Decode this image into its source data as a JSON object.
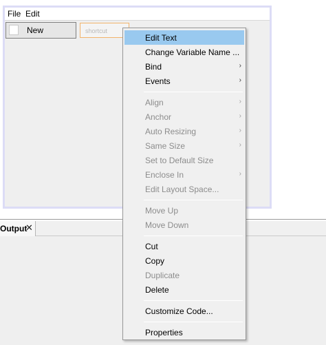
{
  "menubar": {
    "file_label": "File",
    "edit_label": "Edit"
  },
  "designer": {
    "menu_item_label": "New",
    "shortcut_placeholder": "shortcut"
  },
  "output": {
    "tab_label": "Output",
    "close_glyph": "✕"
  },
  "context_menu": {
    "submenu_arrow": "›",
    "items": [
      {
        "label": "Edit Text",
        "enabled": true,
        "highlighted": true,
        "submenu": false
      },
      {
        "label": "Change Variable Name ...",
        "enabled": true,
        "submenu": false
      },
      {
        "label": "Bind",
        "enabled": true,
        "submenu": true
      },
      {
        "label": "Events",
        "enabled": true,
        "submenu": true
      },
      {
        "label": "Align",
        "enabled": false,
        "submenu": true
      },
      {
        "label": "Anchor",
        "enabled": false,
        "submenu": true
      },
      {
        "label": "Auto Resizing",
        "enabled": false,
        "submenu": true
      },
      {
        "label": "Same Size",
        "enabled": false,
        "submenu": true
      },
      {
        "label": "Set to Default Size",
        "enabled": false,
        "submenu": false
      },
      {
        "label": "Enclose In",
        "enabled": false,
        "submenu": true
      },
      {
        "label": "Edit Layout Space...",
        "enabled": false,
        "submenu": false
      },
      {
        "label": "Move Up",
        "enabled": false,
        "submenu": false
      },
      {
        "label": "Move Down",
        "enabled": false,
        "submenu": false
      },
      {
        "label": "Cut",
        "enabled": true,
        "submenu": false
      },
      {
        "label": "Copy",
        "enabled": true,
        "submenu": false
      },
      {
        "label": "Duplicate",
        "enabled": false,
        "submenu": false
      },
      {
        "label": "Delete",
        "enabled": true,
        "submenu": false
      },
      {
        "label": "Customize Code...",
        "enabled": true,
        "submenu": false
      },
      {
        "label": "Properties",
        "enabled": true,
        "submenu": false
      }
    ]
  }
}
